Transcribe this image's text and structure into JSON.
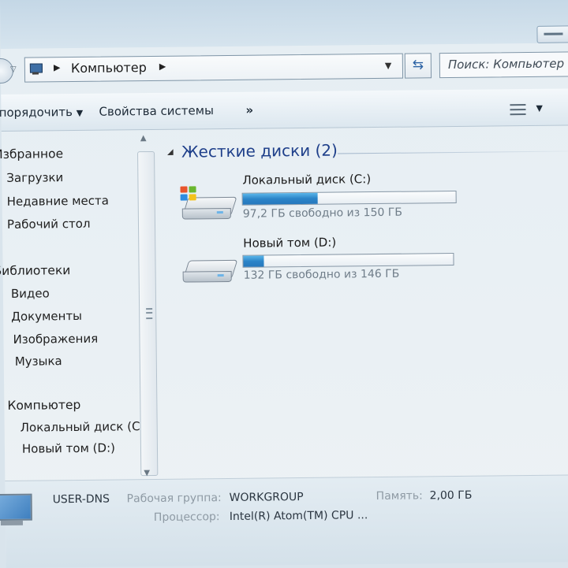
{
  "address": {
    "crumb": "Компьютер",
    "search_placeholder": "Поиск: Компьютер"
  },
  "toolbar": {
    "organize": "Упорядочить",
    "system_properties": "Свойства системы",
    "more": "»"
  },
  "nav": {
    "favorites": "Избранное",
    "downloads": "Загрузки",
    "recent": "Недавние места",
    "desktop": "Рабочий стол",
    "libraries": "Библиотеки",
    "video": "Видео",
    "documents": "Документы",
    "pictures": "Изображения",
    "music": "Музыка",
    "computer": "Компьютер",
    "drive_c": "Локальный диск (C:)",
    "drive_d": "Новый том (D:)"
  },
  "content": {
    "group_title": "Жесткие диски (2)",
    "drives": [
      {
        "name": "Локальный диск (C:)",
        "free_text": "97,2 ГБ свободно из 150 ГБ",
        "used_fraction": 0.352,
        "icon": "windows-drive-icon"
      },
      {
        "name": "Новый том (D:)",
        "free_text": "132 ГБ свободно из 146 ГБ",
        "used_fraction": 0.096,
        "icon": "drive-icon"
      }
    ]
  },
  "details": {
    "computer_name": "USER-DNS",
    "workgroup_label": "Рабочая группа:",
    "workgroup_value": "WORKGROUP",
    "memory_label": "Память:",
    "memory_value": "2,00 ГБ",
    "processor_label": "Процессор:",
    "processor_value": "Intel(R) Atom(TM) CPU ..."
  },
  "colors": {
    "accent_bar": "#2b84c8",
    "group_title": "#1e3f8a"
  }
}
